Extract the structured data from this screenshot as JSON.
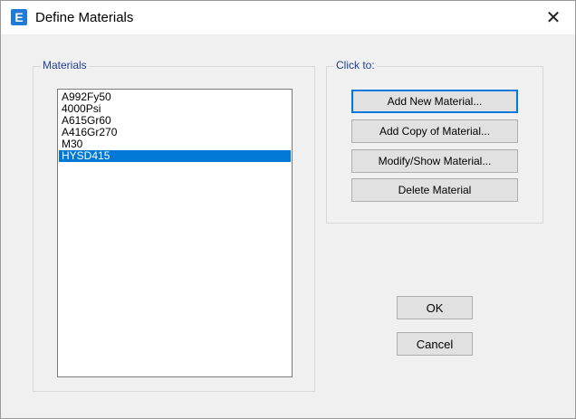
{
  "window": {
    "title": "Define Materials",
    "icon_letter": "E",
    "close_glyph": "✕"
  },
  "materials": {
    "legend": "Materials",
    "items": [
      {
        "label": "A992Fy50",
        "selected": false
      },
      {
        "label": "4000Psi",
        "selected": false
      },
      {
        "label": "A615Gr60",
        "selected": false
      },
      {
        "label": "A416Gr270",
        "selected": false
      },
      {
        "label": "M30",
        "selected": false
      },
      {
        "label": "HYSD415",
        "selected": true
      }
    ]
  },
  "actions": {
    "legend": "Click to:",
    "add_new": "Add New Material...",
    "add_copy": "Add Copy of Material...",
    "modify_show": "Modify/Show Material...",
    "delete": "Delete Material"
  },
  "dialog": {
    "ok": "OK",
    "cancel": "Cancel"
  },
  "colors": {
    "selection": "#0078d7",
    "legend_text": "#1f3f8f",
    "app_icon": "#1e7bd6"
  }
}
